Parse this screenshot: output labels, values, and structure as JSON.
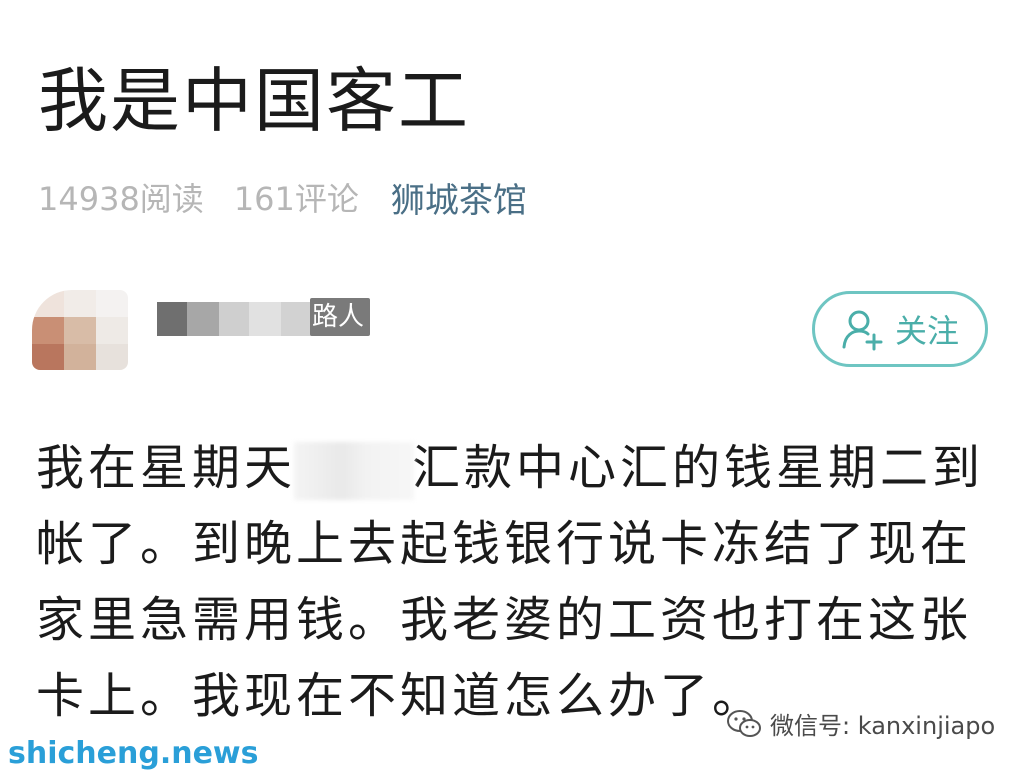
{
  "post": {
    "title": "我是中国客工",
    "reads": "14938阅读",
    "comments": "161评论",
    "forum": "狮城茶馆"
  },
  "author": {
    "name_suffix": "路人",
    "follow_label": "关注"
  },
  "content": {
    "line1_a": "我在星期天",
    "line1_b": "汇款中心汇的钱星期二到",
    "line2": "帐了。到晚上去起钱银行说卡冻结了现在",
    "line3": "家里急需用钱。我老婆的工资也打在这张",
    "line4": "卡上。我现在不知道怎么办了。"
  },
  "footer": {
    "wechat_label": "微信号: kanxinjiapo",
    "watermark": "shicheng.news"
  },
  "colors": {
    "accent": "#6ec5c2",
    "forum": "#4a6f86",
    "watermark": "#2a9fd8"
  },
  "icons": {
    "follow": "add-user-icon",
    "wechat": "wechat-icon"
  }
}
